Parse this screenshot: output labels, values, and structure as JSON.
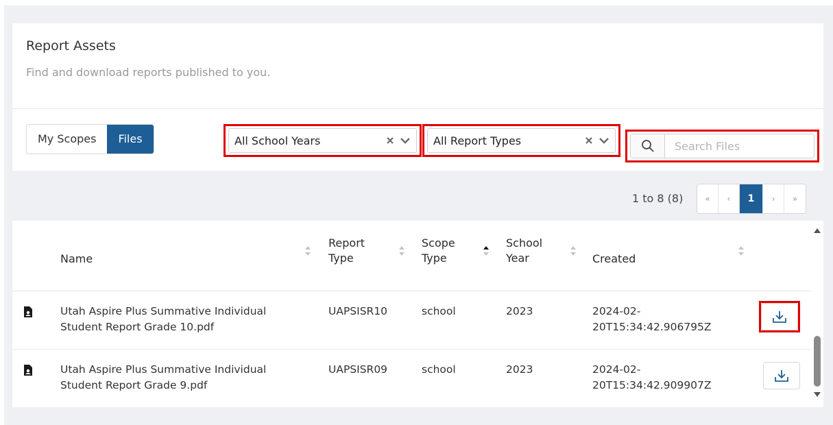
{
  "header": {
    "title": "Report Assets",
    "subtitle": "Find and download reports published to you."
  },
  "view_toggle": {
    "options": [
      "My Scopes",
      "Files"
    ],
    "active": "Files"
  },
  "filters": {
    "school_year": "All School Years",
    "report_type": "All Report Types"
  },
  "search": {
    "placeholder": "Search Files",
    "value": ""
  },
  "pagination": {
    "info": "1 to 8 (8)",
    "first": "«",
    "prev": "‹",
    "current": "1",
    "next": "›",
    "last": "»"
  },
  "table": {
    "columns": {
      "name": "Name",
      "report_type_1": "Report",
      "report_type_2": "Type",
      "scope_type_1": "Scope",
      "scope_type_2": "Type",
      "school_year_1": "School",
      "school_year_2": "Year",
      "created": "Created"
    },
    "sort_column": "Scope Type",
    "sort_direction": "ascending",
    "rows": [
      {
        "name_1": "Utah Aspire Plus Summative Individual",
        "name_2": "Student Report Grade 10.pdf",
        "report_type": "UAPSISR10",
        "scope_type": "school",
        "school_year": "2023",
        "created_1": "2024-02-",
        "created_2": "20T15:34:42.906795Z",
        "action_icon": "download-icon"
      },
      {
        "name_1": "Utah Aspire Plus Summative Individual",
        "name_2": "Student Report Grade 9.pdf",
        "report_type": "UAPSISR09",
        "scope_type": "school",
        "school_year": "2023",
        "created_1": "2024-02-",
        "created_2": "20T15:34:42.909907Z",
        "action_icon": "download-icon"
      }
    ]
  },
  "colors": {
    "accent": "#1e5e96",
    "highlight": "#e00000",
    "background": "#eef0f4"
  }
}
